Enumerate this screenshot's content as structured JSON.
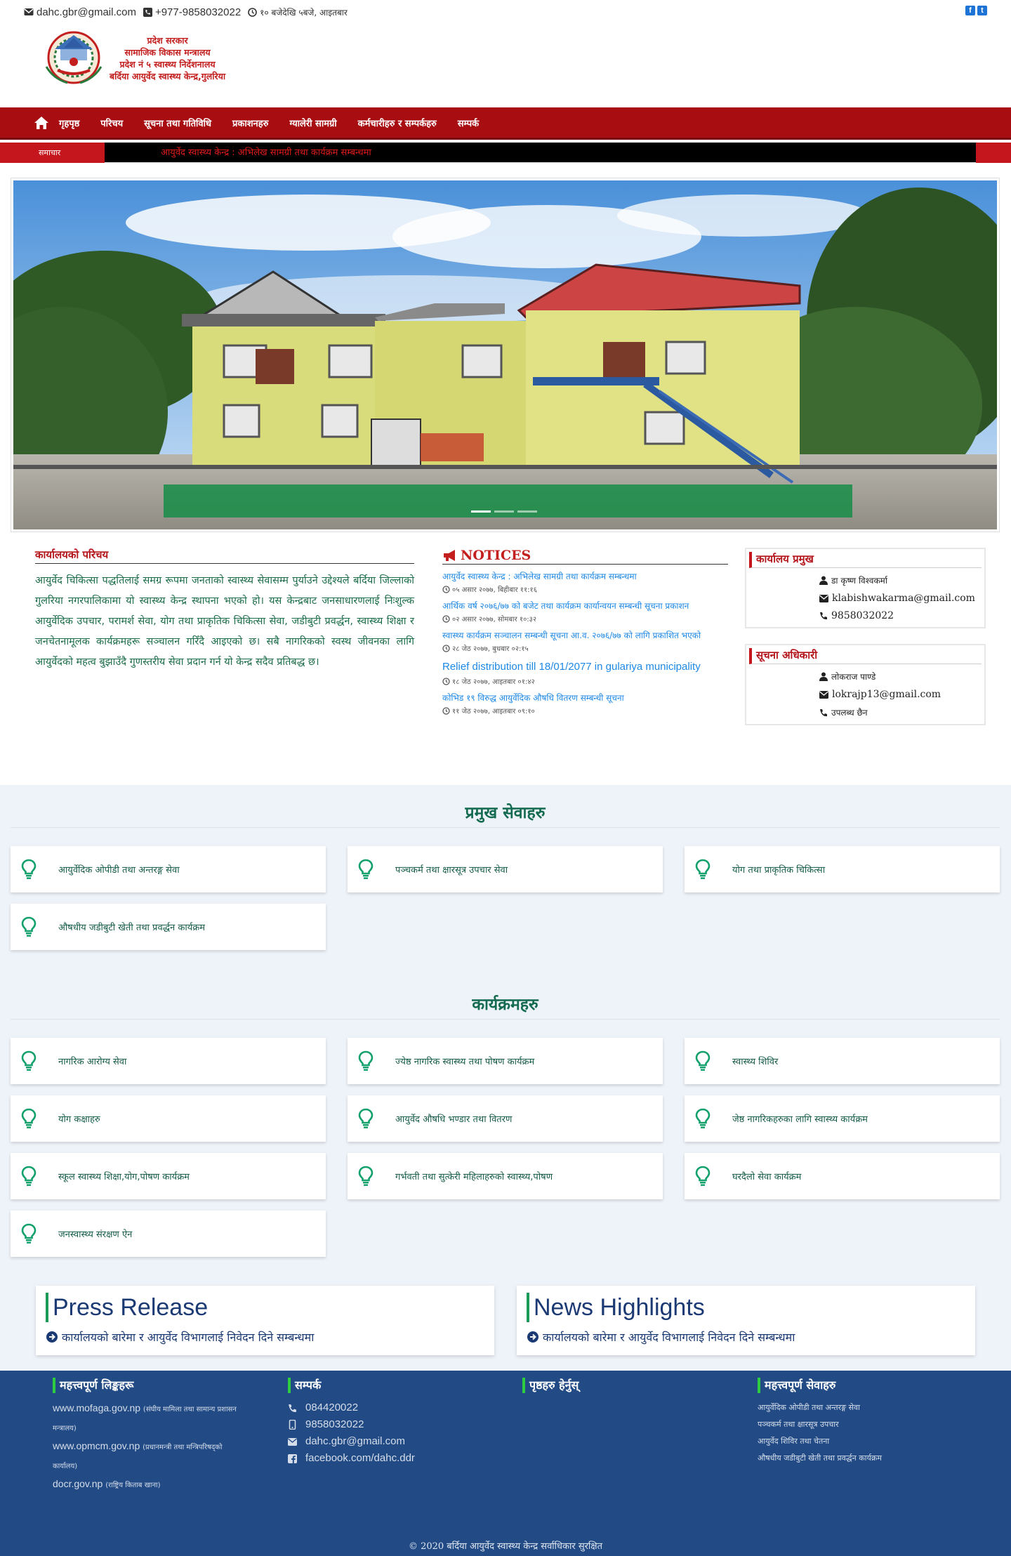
{
  "topbar": {
    "email": "dahc.gbr@gmail.com",
    "phone": "+977-9858032022",
    "hours": "१० बजेदेखि ५बजे, आइतबार",
    "icons": {
      "email": "envelope-icon",
      "phone": "phone-square-icon",
      "clock": "clock-icon"
    },
    "social": [
      {
        "name": "facebook-icon",
        "glyph": "f"
      },
      {
        "name": "twitter-icon",
        "glyph": "t"
      }
    ]
  },
  "logo": {
    "lines": [
      "प्रदेश सरकार",
      "सामाजिक विकास मन्त्रालय",
      "प्रदेश नं ५ स्वास्थ्य निर्देशनालय",
      "बर्दिया आयुर्वेद स्वास्थ्य केन्द्र,गुलरिया"
    ]
  },
  "nav": {
    "items": [
      "गृहपृष्ठ",
      "परिचय",
      "सूचना तथा गतिविधि",
      "प्रकाशनहरु",
      "ग्यालेरी सामग्री",
      "कर्मचारीहरु र सम्पर्कहरु",
      "सम्पर्क"
    ]
  },
  "ticker": {
    "label": "समाचार",
    "message": "आयुर्वेद स्वास्थ्य केन्द्र : अभिलेख सामग्री तथा कार्यक्रम सम्बन्धमा"
  },
  "intro": {
    "heading": "कार्यालयको परिचय",
    "text": "आयुर्वेद चिकित्सा पद्धतिलाई समग्र रूपमा जनताको स्वास्थ्य सेवासम्म पुर्याउने उद्देश्यले बर्दिया जिल्लाको गुलरिया नगरपालिकामा यो स्वास्थ्य केन्द्र स्थापना भएको हो। यस केन्द्रबाट जनसाधारणलाई निःशुल्क आयुर्वेदिक उपचार, परामर्श सेवा, योग तथा प्राकृतिक चिकित्सा सेवा, जडीबुटी प्रवर्द्धन, स्वास्थ्य शिक्षा र जनचेतनामूलक कार्यक्रमहरू सञ्चालन गरिँदै आइएको छ। सबै नागरिकको स्वस्थ जीवनका लागि आयुर्वेदको महत्व बुझाउँदै गुणस्तरीय सेवा प्रदान गर्न यो केन्द्र सदैव प्रतिबद्ध छ।"
  },
  "notices": {
    "heading": "NOTICES",
    "items": [
      {
        "title": "आयुर्वेद स्वास्थ्य केन्द्र : अभिलेख सामग्री तथा कार्यक्रम सम्बन्धमा",
        "date": "०५ असार २०७७, बिहीबार ११:१६",
        "en": false
      },
      {
        "title": "आर्थिक वर्ष २०७६/७७ को बजेट तथा कार्यक्रम कार्यान्वयन सम्बन्धी सूचना प्रकाशन",
        "date": "०२ असार २०७७, सोमबार १०:३२",
        "en": false
      },
      {
        "title": "स्वास्थ्य कार्यक्रम सञ्चालन सम्बन्धी सूचना आ.व. २०७६/७७ को लागि प्रकाशित भएको",
        "date": "२८ जेठ २०७७, बुधबार ०२:१५",
        "en": false
      },
      {
        "title": "Relief distribution till 18/01/2077 in gulariya municipality",
        "date": "१८ जेठ २०७७, आइतबार ०१:४२",
        "en": true
      },
      {
        "title": "कोभिड १९ विरुद्ध आयुर्वेदिक औषधि वितरण सम्बन्धी सूचना",
        "date": "११ जेठ २०७७, आइतबार ०९:१०",
        "en": false
      }
    ]
  },
  "contact_cards": [
    {
      "heading": "कार्यालय प्रमुख",
      "name": "डा कृष्ण विश्वकर्मा",
      "email": "klabishwakarma@gmail.com",
      "phone": "9858032022"
    },
    {
      "heading": "सूचना अधिकारी",
      "name": "लोकराज पाण्डे",
      "email": "lokrajp13@gmail.com",
      "phone": "उपलब्ध छैन"
    }
  ],
  "services_section": {
    "title": "प्रमुख सेवाहरु",
    "tiles": [
      "आयुर्वेदिक ओपीडी तथा अन्तरङ्ग सेवा",
      "पञ्चकर्म तथा क्षारसूत्र उपचार सेवा",
      "योग तथा प्राकृतिक चिकित्सा",
      "औषधीय जडीबुटी खेती तथा प्रवर्द्धन कार्यक्रम"
    ]
  },
  "programs_section": {
    "title": "कार्यक्रमहरु",
    "tiles": [
      "नागरिक आरोग्य सेवा",
      "ज्येष्ठ नागरिक स्वास्थ्य तथा पोषण कार्यक्रम",
      "स्वास्थ्य शिविर",
      "योग कक्षाहरु",
      "आयुर्वेद औषधि भण्डार तथा वितरण",
      "जेष्ठ नागरिकहरुका लागि स्वास्थ्य कार्यक्रम",
      "स्कूल स्वास्थ्य शिक्षा,योग,पोषण कार्यक्रम",
      "गर्भवती तथा सुत्केरी महिलाहरुको स्वास्थ्य,पोषण",
      "घरदैलो सेवा कार्यक्रम",
      "जनस्वास्थ्य संरक्षण ऐन"
    ]
  },
  "press": [
    {
      "title": "Press Release",
      "item": "कार्यालयको बारेमा र आयुर्वेद विभागलाई निवेदन दिने सम्बन्धमा"
    },
    {
      "title": "News Highlights",
      "item": "कार्यालयको बारेमा र आयुर्वेद विभागलाई निवेदन दिने सम्बन्धमा"
    }
  ],
  "footer": {
    "col1": {
      "heading": "महत्त्वपूर्ण लिङ्कहरू",
      "links": [
        {
          "url": "www.mofaga.gov.np",
          "note": "(संघीय मामिला तथा सामान्य प्रशासन मन्त्रालय)"
        },
        {
          "url": "www.opmcm.gov.np",
          "note": "(प्रधानमन्त्री तथा मन्त्रिपरिषद्को कार्यालय)"
        },
        {
          "url": "docr.gov.np",
          "note": "(राष्ट्रिय किताब खाना)"
        }
      ]
    },
    "col2": {
      "heading": "सम्पर्क",
      "rows": [
        {
          "icon": "phone-icon",
          "text": "084420022"
        },
        {
          "icon": "mobile-icon",
          "text": "9858032022"
        },
        {
          "icon": "envelope-icon",
          "text": "dahc.gbr@gmail.com"
        },
        {
          "icon": "facebook-square-icon",
          "text": "facebook.com/dahc.ddr"
        }
      ]
    },
    "col3": {
      "heading": "पृष्ठहरु हेर्नुस्"
    },
    "col4": {
      "heading": "महत्त्वपूर्ण सेवाहरु",
      "items": [
        "आयुर्वेदिक ओपीडी तथा अन्तरङ्ग सेवा",
        "पञ्चकर्म तथा क्षारसूत्र उपचार",
        "आयुर्वेद शिविर तथा चेतना",
        "औषधीय जडीबुटी खेती तथा प्रवर्द्धन कार्यक्रम"
      ]
    },
    "copyright": "© 2020 बर्दिया आयुर्वेद स्वास्थ्य केन्द्र सर्वाधिकार सुरक्षित"
  }
}
